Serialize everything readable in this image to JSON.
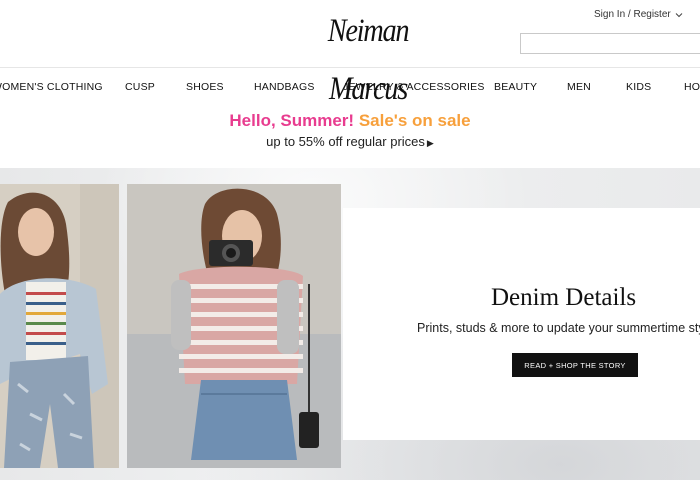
{
  "header": {
    "logo": "Neiman Marcus",
    "signin_label": "Sign In / Register",
    "search_placeholder": ""
  },
  "nav": {
    "items": [
      {
        "label": "WOMEN'S CLOTHING"
      },
      {
        "label": "CUSP"
      },
      {
        "label": "SHOES"
      },
      {
        "label": "HANDBAGS"
      },
      {
        "label": "JEWELRY & ACCESSORIES"
      },
      {
        "label": "BEAUTY"
      },
      {
        "label": "MEN"
      },
      {
        "label": "KIDS"
      },
      {
        "label": "HOME"
      }
    ]
  },
  "promo": {
    "hello": "Hello, Summer!",
    "sale": "Sale's on sale",
    "offer": "up to 55% off regular prices"
  },
  "hero": {
    "title": "Denim Details",
    "subtitle": "Prints, studs & more to update your summertime style",
    "cta": "READ + SHOP THE STORY"
  },
  "colors": {
    "hello": "#e83c8f",
    "sale": "#f7a03c",
    "cta_bg": "#111111"
  }
}
